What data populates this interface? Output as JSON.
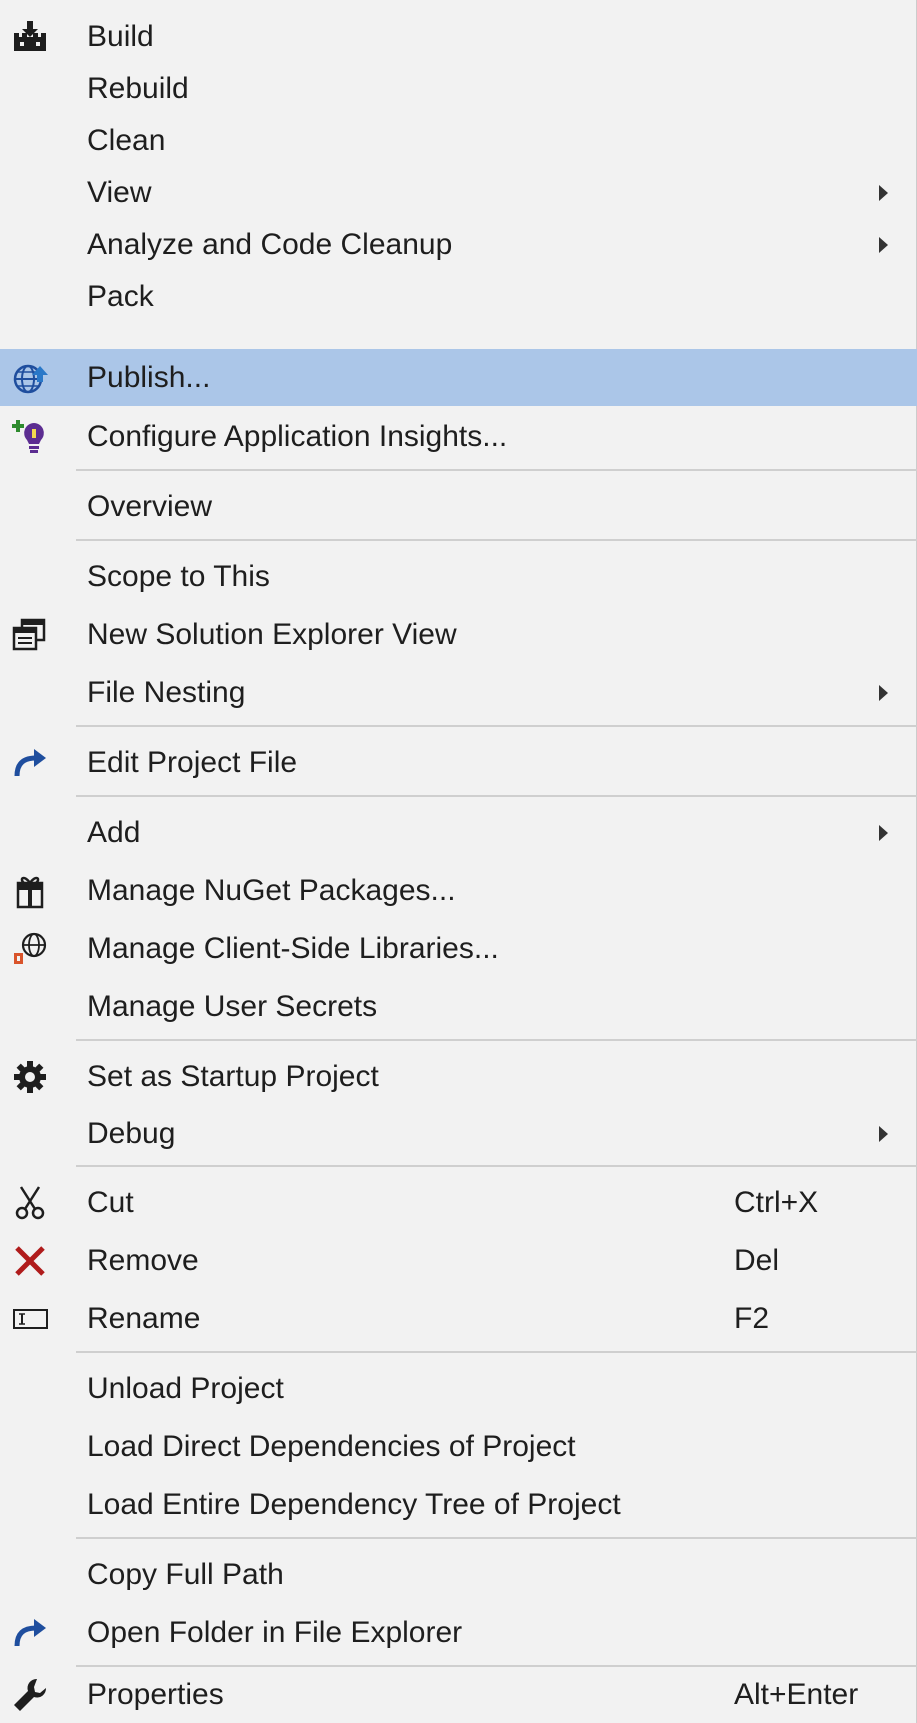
{
  "menu": {
    "build": {
      "label": "Build",
      "icon": "build-icon"
    },
    "rebuild": {
      "label": "Rebuild"
    },
    "clean": {
      "label": "Clean"
    },
    "view": {
      "label": "View"
    },
    "analyze": {
      "label": "Analyze and Code Cleanup"
    },
    "pack": {
      "label": "Pack"
    },
    "publish": {
      "label": "Publish...",
      "icon": "publish-globe-icon",
      "highlighted": true
    },
    "configure_insights": {
      "label": "Configure Application Insights...",
      "icon": "application-insights-icon"
    },
    "overview": {
      "label": "Overview"
    },
    "scope_to_this": {
      "label": "Scope to This"
    },
    "new_solution_explorer_view": {
      "label": "New Solution Explorer View",
      "icon": "new-window-icon"
    },
    "file_nesting": {
      "label": "File Nesting"
    },
    "edit_project_file": {
      "label": "Edit Project File",
      "icon": "redo-arrow-icon"
    },
    "add": {
      "label": "Add"
    },
    "manage_nuget": {
      "label": "Manage NuGet Packages...",
      "icon": "nuget-package-icon"
    },
    "manage_client_libraries": {
      "label": "Manage Client-Side Libraries...",
      "icon": "client-libraries-icon"
    },
    "manage_user_secrets": {
      "label": "Manage User Secrets"
    },
    "set_startup": {
      "label": "Set as Startup Project",
      "icon": "gear-icon"
    },
    "debug": {
      "label": "Debug"
    },
    "cut": {
      "label": "Cut",
      "shortcut": "Ctrl+X",
      "icon": "scissors-icon"
    },
    "remove": {
      "label": "Remove",
      "shortcut": "Del",
      "icon": "remove-x-icon"
    },
    "rename": {
      "label": "Rename",
      "shortcut": "F2",
      "icon": "rename-icon"
    },
    "unload_project": {
      "label": "Unload Project"
    },
    "load_direct": {
      "label": "Load Direct Dependencies of Project"
    },
    "load_entire": {
      "label": "Load Entire Dependency Tree of Project"
    },
    "copy_full_path": {
      "label": "Copy Full Path"
    },
    "open_in_explorer": {
      "label": "Open Folder in File Explorer",
      "icon": "redo-arrow-icon"
    },
    "properties": {
      "label": "Properties",
      "shortcut": "Alt+Enter",
      "icon": "wrench-icon"
    }
  },
  "colors": {
    "background": "#f2f2f2",
    "highlight": "#abc6e8",
    "separator": "#cfcfcf",
    "text": "#1e1e1e",
    "icon_blue": "#1f4e9e",
    "icon_red": "#b01c1c"
  }
}
